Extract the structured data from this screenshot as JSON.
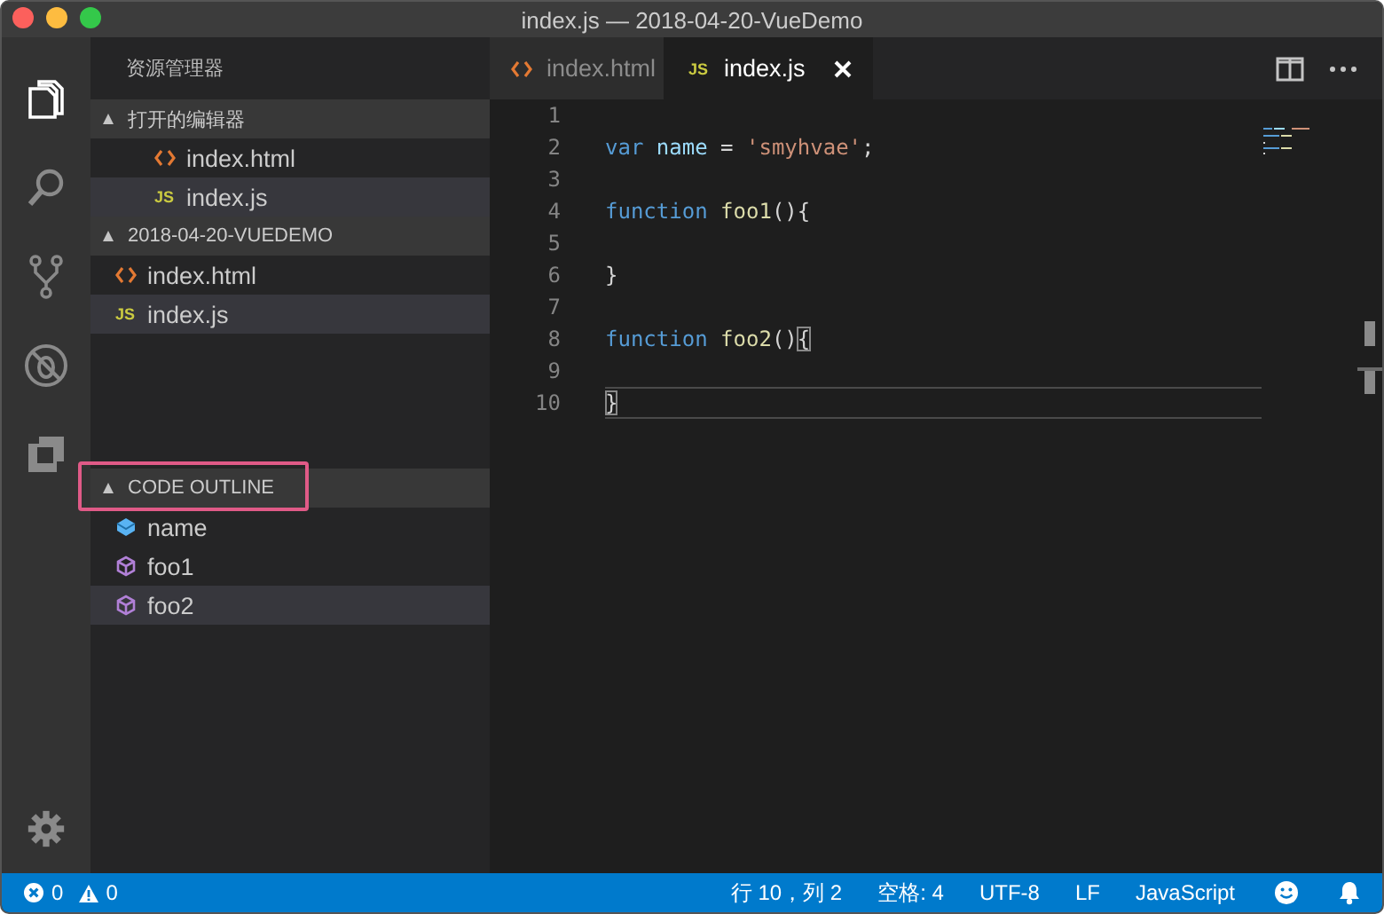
{
  "window": {
    "title": "index.js — 2018-04-20-VueDemo"
  },
  "activity_bar": [
    {
      "kind": "files",
      "selected": true
    },
    {
      "kind": "search",
      "selected": false
    },
    {
      "kind": "source-control",
      "selected": false
    },
    {
      "kind": "debug",
      "selected": false
    },
    {
      "kind": "extensions",
      "selected": false
    }
  ],
  "sidebar": {
    "title": "资源管理器",
    "sections": [
      {
        "title": "打开的编辑器",
        "expanded": true,
        "nested": true,
        "items": [
          {
            "label": "index.html",
            "kind": "html",
            "selected": false
          },
          {
            "label": "index.js",
            "kind": "js",
            "icon_text": "JS",
            "selected": true
          }
        ]
      },
      {
        "title": "2018-04-20-VUEDEMO",
        "expanded": true,
        "nested": false,
        "items": [
          {
            "label": "index.html",
            "kind": "html",
            "selected": false
          },
          {
            "label": "index.js",
            "kind": "js",
            "icon_text": "JS",
            "selected": true
          }
        ]
      }
    ],
    "outline": {
      "title": "CODE OUTLINE",
      "expanded": true,
      "highlighted": true,
      "items": [
        {
          "label": "name",
          "kind": "variable",
          "selected": false
        },
        {
          "label": "foo1",
          "kind": "function",
          "selected": false
        },
        {
          "label": "foo2",
          "kind": "function",
          "selected": true
        }
      ]
    }
  },
  "tabs": [
    {
      "label": "index.html",
      "kind": "html",
      "selected": false
    },
    {
      "label": "index.js",
      "kind": "js",
      "icon_text": "JS",
      "selected": true
    }
  ],
  "code": {
    "lines": [
      {
        "number": "1",
        "current": false
      },
      {
        "number": "2",
        "current": false,
        "tokens": [
          {
            "kind": "keyword",
            "text": "var "
          },
          {
            "kind": "variable",
            "text": "name"
          },
          {
            "kind": "plain",
            "text": " = "
          },
          {
            "kind": "string",
            "text": "'smyhvae'"
          },
          {
            "kind": "plain",
            "text": ";"
          }
        ]
      },
      {
        "number": "3",
        "current": false
      },
      {
        "number": "4",
        "current": false,
        "tokens": [
          {
            "kind": "keyword",
            "text": "function "
          },
          {
            "kind": "function",
            "text": "foo1"
          },
          {
            "kind": "plain",
            "text": "(){"
          }
        ]
      },
      {
        "number": "5",
        "current": false
      },
      {
        "number": "6",
        "current": false,
        "tokens": [
          {
            "kind": "plain",
            "text": "}"
          }
        ]
      },
      {
        "number": "7",
        "current": false
      },
      {
        "number": "8",
        "current": false,
        "tokens": [
          {
            "kind": "keyword",
            "text": "function "
          },
          {
            "kind": "function",
            "text": "foo2"
          },
          {
            "kind": "plain",
            "text": "()"
          },
          {
            "kind": "bracket-match",
            "text": "{"
          }
        ]
      },
      {
        "number": "9",
        "current": false
      },
      {
        "number": "10",
        "current": true,
        "tokens": [
          {
            "kind": "bracket-match",
            "text": "}"
          }
        ]
      }
    ]
  },
  "status_bar": {
    "errors": "0",
    "warnings": "0",
    "items": [
      "行 10，列 2",
      "空格: 4",
      "UTF-8",
      "LF",
      "JavaScript"
    ]
  }
}
